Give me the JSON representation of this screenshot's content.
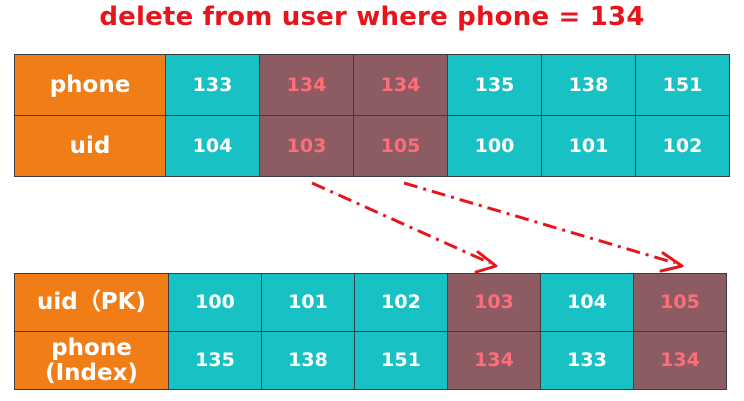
{
  "title": "delete from user where phone = 134",
  "secondary_index": {
    "headers": [
      "phone",
      "uid"
    ],
    "phone": [
      "133",
      "134",
      "134",
      "135",
      "138",
      "151"
    ],
    "uid": [
      "104",
      "103",
      "105",
      "100",
      "101",
      "102"
    ],
    "highlighted_columns": [
      1,
      2
    ]
  },
  "primary_table": {
    "headers": [
      "uid（PK)",
      "phone",
      "(Index)"
    ],
    "uid": [
      "100",
      "101",
      "102",
      "103",
      "104",
      "105"
    ],
    "phone": [
      "135",
      "138",
      "151",
      "134",
      "133",
      "134"
    ],
    "highlighted_columns": [
      3,
      5
    ]
  },
  "colors": {
    "title": "#e8141b",
    "header_fill": "#f07d16",
    "cell_fill": "#17c1c4",
    "highlight_fill": "#8c5c62",
    "highlight_text": "#ff6d78",
    "arrow": "#e8141b"
  }
}
